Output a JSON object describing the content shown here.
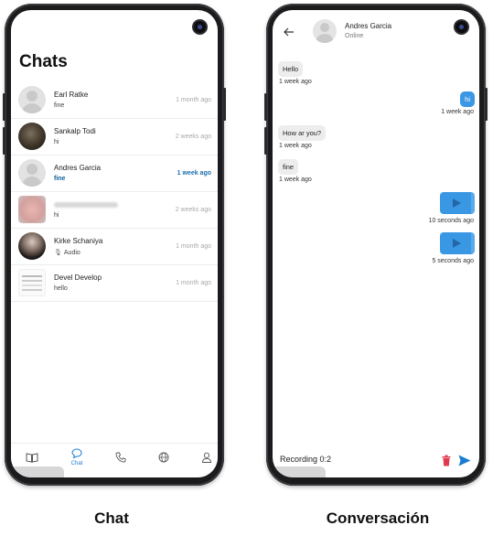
{
  "chat_screen": {
    "title": "Chats",
    "chats": [
      {
        "name": "Earl Ratke",
        "message": "fine",
        "time": "1 month ago",
        "unread": false,
        "avatar": "placeholder-avatar"
      },
      {
        "name": "Sankalp Todi",
        "message": "hi",
        "time": "2 weeks ago",
        "unread": false,
        "avatar": "photo-avatar"
      },
      {
        "name": "Andres Garcia",
        "message": "fine",
        "time": "1 week ago",
        "unread": true,
        "avatar": "placeholder-avatar"
      },
      {
        "name": "",
        "message": "hi",
        "time": "2 weeks ago",
        "unread": false,
        "avatar": "blurred-photo-avatar"
      },
      {
        "name": "Kirke Schaniya",
        "message": "Audio",
        "time": "1 month ago",
        "unread": false,
        "avatar": "photo-avatar"
      },
      {
        "name": "Devel Develop",
        "message": "hello",
        "time": "1 month ago",
        "unread": false,
        "avatar": "document-avatar"
      }
    ],
    "nav": {
      "active_label": "Chat",
      "items": [
        "book-icon",
        "chat-icon",
        "phone-icon",
        "globe-icon",
        "person-icon"
      ]
    }
  },
  "conversation_screen": {
    "contact_name": "Andres Garcia",
    "status": "Online",
    "messages": [
      {
        "side": "in",
        "text": "Hello",
        "time": "1 week ago"
      },
      {
        "side": "out",
        "text": "hi",
        "time": "1 week ago"
      },
      {
        "side": "in",
        "text": "How ar you?",
        "time": "1 week ago"
      },
      {
        "side": "in",
        "text": "fine",
        "time": "1 week ago"
      },
      {
        "side": "out",
        "type": "audio",
        "time": "10 seconds ago"
      },
      {
        "side": "out",
        "type": "audio",
        "time": "5 seconds ago"
      }
    ],
    "recording_text": "Recording 0:2"
  },
  "captions": {
    "left": "Chat",
    "right": "Conversación"
  },
  "colors": {
    "accent": "#1a7bd1",
    "outgoing_bubble": "#3a97e3",
    "unread_text": "#1a6fb0",
    "trash": "#e03a4f"
  }
}
